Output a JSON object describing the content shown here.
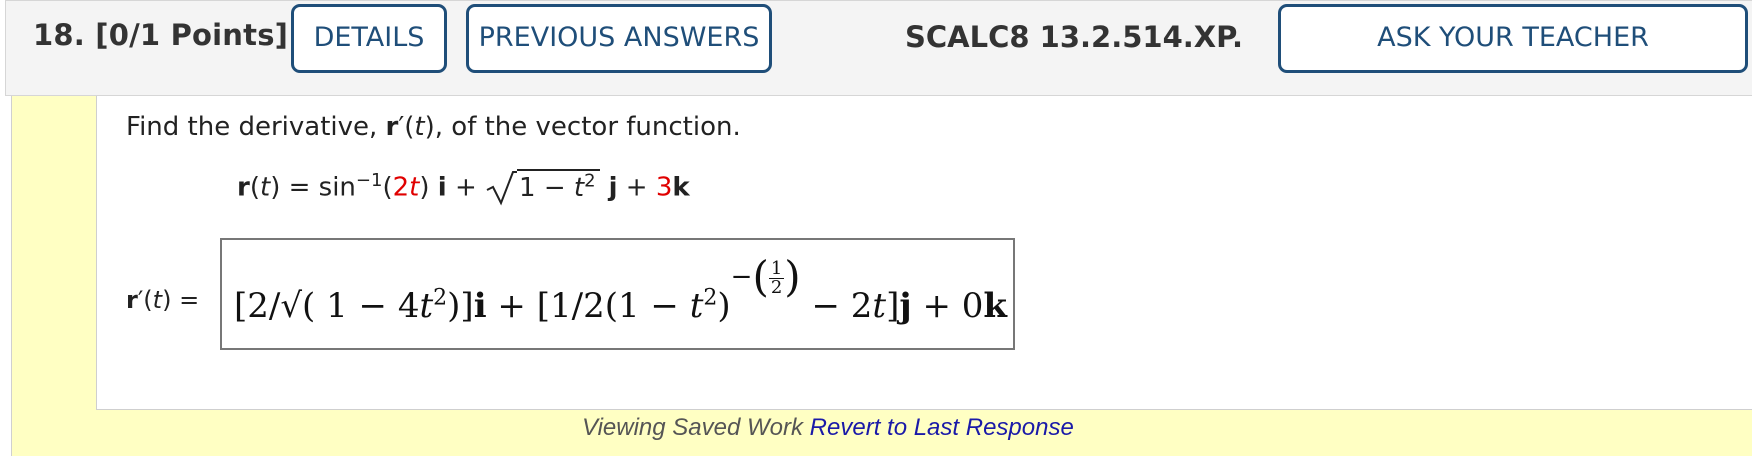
{
  "header": {
    "question_label": "18.  [0/1 Points]",
    "details_button": "DETAILS",
    "previous_answers_button": "PREVIOUS ANSWERS",
    "source_code": "SCALC8 13.2.514.XP.",
    "ask_teacher_button": "ASK YOUR TEACHER"
  },
  "question": {
    "prompt_pre": "Find the derivative, ",
    "prompt_r": "r",
    "prompt_mid": "′(",
    "prompt_t": "t",
    "prompt_post": "), of the vector function.",
    "given": {
      "r": "r",
      "t": "t",
      "open": "(",
      "close_eq": ") = ",
      "func": "sin",
      "exp": "−1",
      "arg_open": "(",
      "arg_red": "2",
      "arg_t": "t",
      "arg_close": ") ",
      "i": "i",
      "plus1": " + ",
      "radicand_pre": "1 − ",
      "radicand_t": "t",
      "radicand_exp": "2",
      "j": " j",
      "plus2": " + ",
      "k_coef": "3",
      "k": "k"
    }
  },
  "answer": {
    "label_r": "r",
    "label_rest": "′(",
    "label_t": "t",
    "label_end": ") =",
    "expr": {
      "part1": "[2/",
      "sqrt": "√",
      "part2": "( 1 − 4",
      "t1": "t",
      "exp1": "2",
      "part3": ")]",
      "i": "i",
      "part4": " + [1/2(1 − ",
      "t2": "t",
      "exp2": "2",
      "part5": ")",
      "neg": "−",
      "frac_num": "1",
      "frac_den": "2",
      "part6": " − 2",
      "t3": "t",
      "part7": "]",
      "j": "j",
      "part8": " + 0",
      "k": "k"
    }
  },
  "footer": {
    "viewing_text": "Viewing Saved Work ",
    "revert_link": "Revert to Last Response"
  },
  "colors": {
    "button_border": "#1f4e79",
    "header_bg": "#f4f4f4",
    "side_bg": "#ffffc3",
    "highlight_red": "#e00000",
    "link": "#1a1aa8"
  }
}
